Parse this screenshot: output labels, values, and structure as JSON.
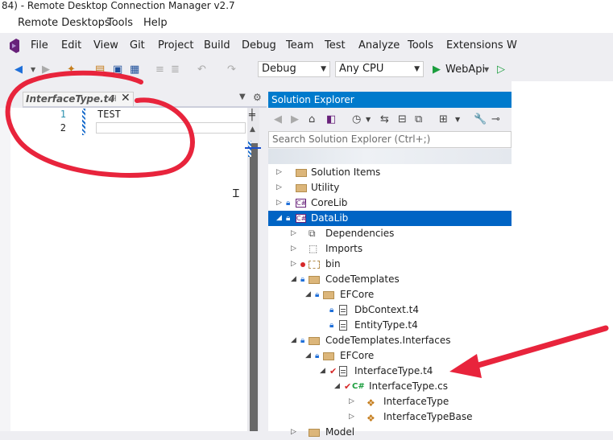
{
  "window": {
    "title": "84) - Remote Desktop Connection Manager v2.7"
  },
  "rdcm_menu": [
    "Remote Desktops",
    "Tools",
    "Help"
  ],
  "vs_menu": [
    "File",
    "Edit",
    "View",
    "Git",
    "Project",
    "Build",
    "Debug",
    "Team",
    "Test",
    "Analyze",
    "Tools",
    "Extensions",
    "W"
  ],
  "toolbar": {
    "config": "Debug",
    "platform": "Any CPU",
    "run_target": "WebApi"
  },
  "editor": {
    "tab_label": "InterfaceType.t4",
    "lines": [
      {
        "num": "1",
        "text": "TEST"
      },
      {
        "num": "2",
        "text": ""
      }
    ]
  },
  "solution_explorer": {
    "title": "Solution Explorer",
    "search_placeholder": "Search Solution Explorer (Ctrl+;)",
    "items": [
      {
        "label": "Solution Items",
        "icon": "folder-icon"
      },
      {
        "label": "Utility",
        "icon": "folder-icon"
      },
      {
        "label": "CoreLib",
        "icon": "csharp-project-icon"
      },
      {
        "label": "DataLib",
        "icon": "csharp-project-icon",
        "selected": true
      },
      {
        "label": "Dependencies",
        "icon": "dependencies-icon"
      },
      {
        "label": "Imports",
        "icon": "imports-icon"
      },
      {
        "label": "bin",
        "icon": "folder-icon"
      },
      {
        "label": "CodeTemplates",
        "icon": "folder-icon"
      },
      {
        "label": "EFCore",
        "icon": "folder-icon"
      },
      {
        "label": "DbContext.t4",
        "icon": "file-icon"
      },
      {
        "label": "EntityType.t4",
        "icon": "file-icon"
      },
      {
        "label": "CodeTemplates.Interfaces",
        "icon": "folder-icon"
      },
      {
        "label": "EFCore",
        "icon": "folder-icon"
      },
      {
        "label": "InterfaceType.t4",
        "icon": "file-icon"
      },
      {
        "label": "InterfaceType.cs",
        "icon": "csharp-file-icon"
      },
      {
        "label": "InterfaceType",
        "icon": "class-icon"
      },
      {
        "label": "InterfaceTypeBase",
        "icon": "class-icon"
      },
      {
        "label": "Model",
        "icon": "folder-icon"
      }
    ]
  },
  "colors": {
    "accent": "#007acc",
    "selection": "#0064c4",
    "annotation": "#e8243c"
  }
}
